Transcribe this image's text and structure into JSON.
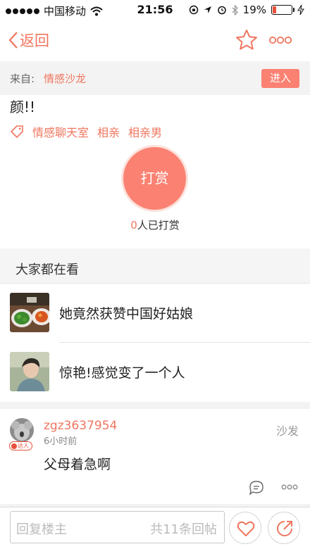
{
  "status_bar": {
    "carrier": "中国移动",
    "time": "21:56",
    "battery_percent": "19%",
    "battery_level": 0.19,
    "icons": [
      "signal-dots-icon",
      "wifi-icon",
      "orientation-lock-icon",
      "location-arrow-icon",
      "alarm-icon",
      "bluetooth-icon",
      "battery-icon",
      "charging-bolt-icon"
    ]
  },
  "nav": {
    "back_label": "返回",
    "icons": [
      "back-chevron-icon",
      "star-icon",
      "more-dots-icon"
    ]
  },
  "source": {
    "label": "来自:",
    "name": "情感沙龙",
    "enter_label": "进入"
  },
  "post": {
    "body_tail": "颜!!",
    "tags": [
      "情感聊天室",
      "相亲",
      "相亲男"
    ],
    "tag_icon": "tag-icon"
  },
  "reward": {
    "button_label": "打赏",
    "count": "0",
    "count_suffix": "人已打赏"
  },
  "recommend": {
    "section_title": "大家都在看",
    "items": [
      {
        "title": "她竟然获赞中国好姑娘",
        "thumb": "food-photo"
      },
      {
        "title": "惊艳!感觉变了一个人",
        "thumb": "person-photo"
      }
    ]
  },
  "reply": {
    "username": "zgz3637954",
    "time_ago": "6小时前",
    "floor": "沙发",
    "badge": "达人",
    "text": "父母着急啊",
    "icons": [
      "comment-icon",
      "more-dots-icon"
    ]
  },
  "bottom_bar": {
    "input_placeholder": "回复楼主",
    "reply_count_text": "共11条回帖",
    "icons": [
      "heart-icon",
      "share-icon"
    ]
  },
  "colors": {
    "accent": "#f0765f",
    "button_fill": "#fb8172",
    "battery_low": "#e8503a",
    "section_bg": "#f5f5f5"
  }
}
